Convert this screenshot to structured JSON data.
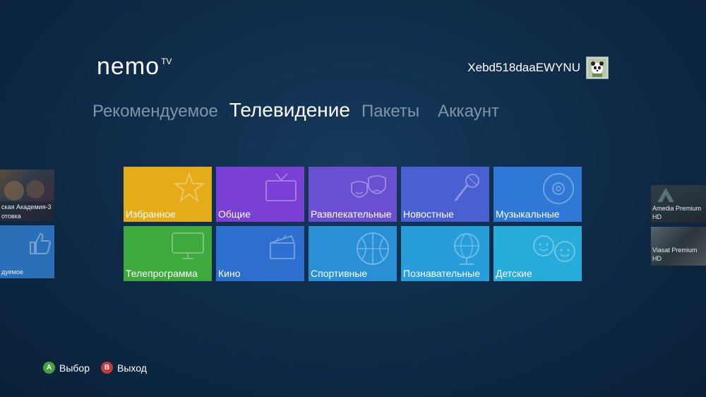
{
  "app": {
    "logo_main": "nemo",
    "logo_sup": "TV"
  },
  "user": {
    "name": "Xebd518daaEWYNU",
    "avatar_icon": "panda-avatar-icon"
  },
  "nav": {
    "items": [
      {
        "label": "Рекомендуемое",
        "active": false
      },
      {
        "label": "Телевидение",
        "active": true
      },
      {
        "label": "Пакеты",
        "active": false
      },
      {
        "label": "Аккаунт",
        "active": false
      }
    ]
  },
  "tiles": [
    {
      "label": "Избранное",
      "color": "#e5ac1a",
      "icon": "star-icon"
    },
    {
      "label": "Общие",
      "color": "#7a3fd4",
      "icon": "tv-icon"
    },
    {
      "label": "Развлекательные",
      "color": "#6a4fd0",
      "icon": "theater-masks-icon"
    },
    {
      "label": "Новостные",
      "color": "#4a60d2",
      "icon": "microphone-icon"
    },
    {
      "label": "Музыкальные",
      "color": "#2f78d6",
      "icon": "music-disc-icon"
    },
    {
      "label": "Телепрограмма",
      "color": "#3ea93c",
      "icon": "monitor-icon"
    },
    {
      "label": "Кино",
      "color": "#2c6fce",
      "icon": "clapperboard-icon"
    },
    {
      "label": "Спортивные",
      "color": "#2990d6",
      "icon": "basketball-icon"
    },
    {
      "label": "Познавательные",
      "color": "#279ed9",
      "icon": "globe-icon"
    },
    {
      "label": "Детские",
      "color": "#27acd9",
      "icon": "kids-faces-icon"
    }
  ],
  "left_side": {
    "item1_text_line1": "ская Академия-3",
    "item1_text_line2": "отовка",
    "item2_text": "дуемое"
  },
  "right_side": {
    "item1_line1": "Amedia Premium",
    "item1_line2": "HD",
    "item2_line1": "Viasat Premium",
    "item2_line2": "HD"
  },
  "footer": {
    "a_key": "A",
    "a_label": "Выбор",
    "a_color": "#4aa23e",
    "b_key": "B",
    "b_label": "Выход",
    "b_color": "#c23a3a"
  }
}
